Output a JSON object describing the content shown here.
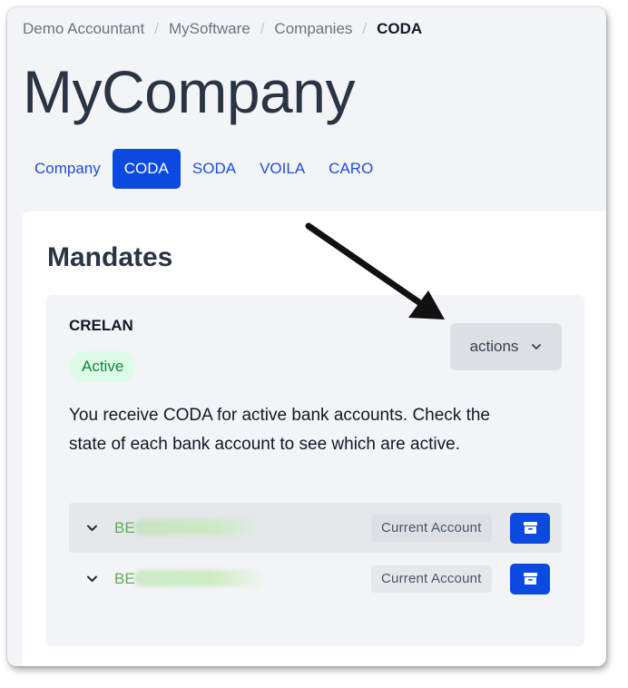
{
  "breadcrumb": {
    "items": [
      "Demo Accountant",
      "MySoftware",
      "Companies"
    ],
    "current": "CODA",
    "separator": "/"
  },
  "page": {
    "title": "MyCompany"
  },
  "tabs": [
    {
      "label": "Company",
      "active": false
    },
    {
      "label": "CODA",
      "active": true
    },
    {
      "label": "SODA",
      "active": false
    },
    {
      "label": "VOILA",
      "active": false
    },
    {
      "label": "CARO",
      "active": false
    }
  ],
  "mandates": {
    "title": "Mandates",
    "bank": "CRELAN",
    "status": "Active",
    "actions_label": "actions",
    "description": "You receive CODA for active bank accounts. Check the state of each bank account to see which are active.",
    "accounts": [
      {
        "iban_prefix": "BE",
        "type": "Current Account"
      },
      {
        "iban_prefix": "BE",
        "type": "Current Account"
      }
    ]
  },
  "icons": {
    "expand": "chevron-down-icon",
    "archive": "archive-icon",
    "actions_dropdown": "chevron-down-icon"
  },
  "colors": {
    "primary": "#0b4ae0",
    "link": "#1d4ed8",
    "success_bg": "#dcfce7",
    "success_text": "#15803d",
    "iban_text": "#5ab24b"
  }
}
